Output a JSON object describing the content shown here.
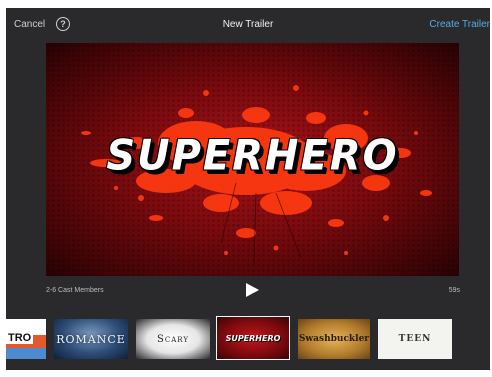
{
  "header": {
    "cancel_label": "Cancel",
    "help_label": "?",
    "title": "New Trailer",
    "create_label": "Create Trailer"
  },
  "preview": {
    "trailer_title": "SUPERHERO",
    "cast_members": "2-6 Cast Members",
    "duration": "59s"
  },
  "templates": [
    {
      "label": "TRO"
    },
    {
      "label": "ROMANCE"
    },
    {
      "label": "Scary"
    },
    {
      "label": "SUPERHERO",
      "selected": true
    },
    {
      "label": "Swashbuckler"
    },
    {
      "label": "TEEN"
    }
  ],
  "colors": {
    "accent": "#5aa9e6",
    "background": "#2a2a2c",
    "preview_red": "#a8141a",
    "splatter": "#ff3a10"
  },
  "icons": {
    "help": "question-circle-icon",
    "play": "play-icon"
  }
}
